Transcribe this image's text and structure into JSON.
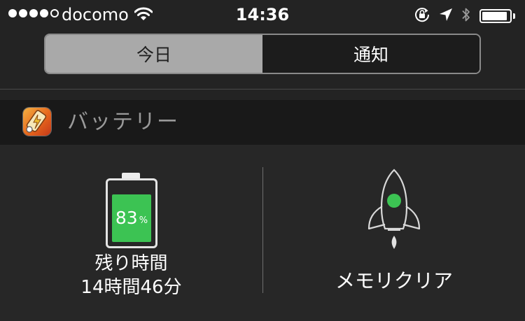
{
  "status_bar": {
    "signal_filled": 4,
    "signal_total": 5,
    "carrier": "docomo",
    "time": "14:36",
    "battery_level": 0.92
  },
  "segmented": {
    "tabs": [
      {
        "label": "今日",
        "active": true
      },
      {
        "label": "通知",
        "active": false
      }
    ]
  },
  "widget": {
    "title": "バッテリー",
    "battery": {
      "percent_value": "83",
      "percent_sign": "%",
      "level": 0.83,
      "remaining_label": "残り時間",
      "remaining_value": "14時間46分",
      "fill_color": "#3cc353"
    },
    "memory": {
      "label": "メモリクリア",
      "icon": "rocket-icon",
      "accent": "#3cc353"
    }
  }
}
